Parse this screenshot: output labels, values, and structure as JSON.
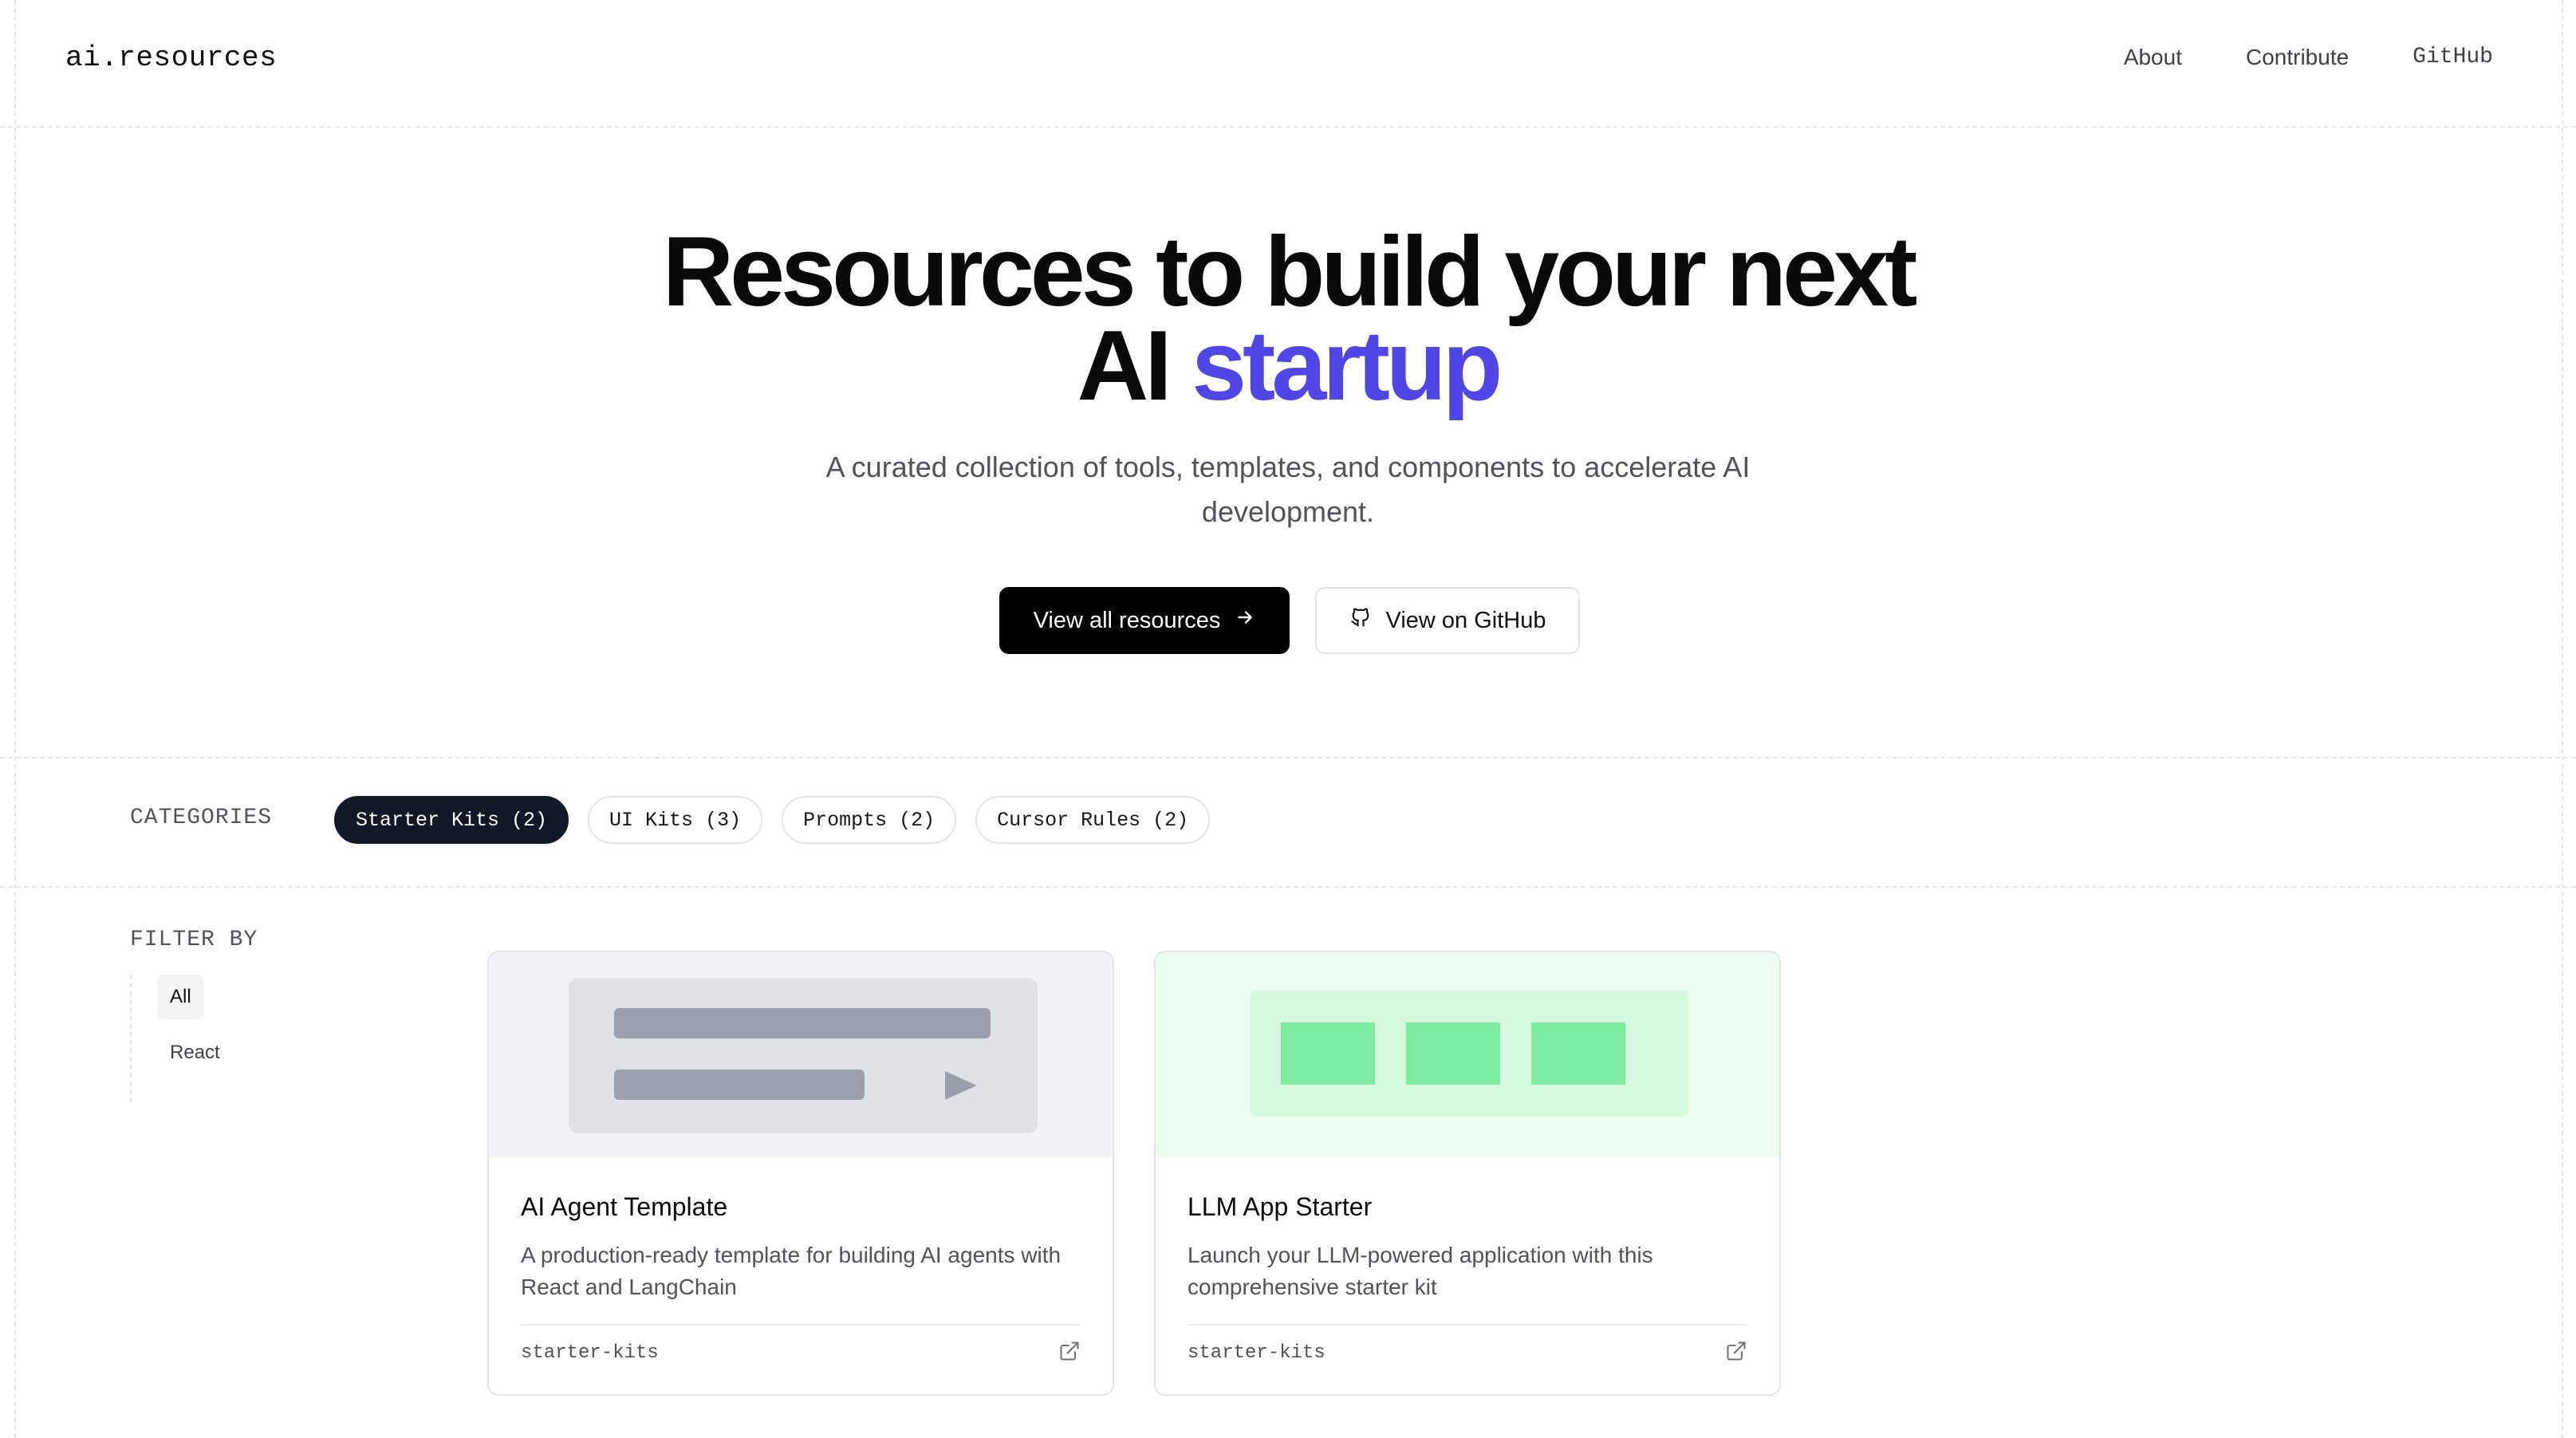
{
  "header": {
    "logo": "ai.resources",
    "nav": [
      {
        "label": "About"
      },
      {
        "label": "Contribute"
      },
      {
        "label": "GitHub"
      }
    ]
  },
  "hero": {
    "title_line1": "Resources to build your next",
    "title_line2_plain": "AI",
    "title_line2_highlight": "startup",
    "subtitle": "A curated collection of tools, templates, and components to accelerate AI development.",
    "primary_button": "View all resources",
    "secondary_button": "View on GitHub"
  },
  "categories": {
    "label": "CATEGORIES",
    "chips": [
      {
        "label": "Starter Kits (2)",
        "active": true
      },
      {
        "label": "UI Kits (3)",
        "active": false
      },
      {
        "label": "Prompts (2)",
        "active": false
      },
      {
        "label": "Cursor Rules (2)",
        "active": false
      }
    ]
  },
  "filter": {
    "label": "FILTER BY",
    "items": [
      {
        "label": "All",
        "active": true
      },
      {
        "label": "React",
        "active": false
      }
    ]
  },
  "cards": [
    {
      "title": "AI Agent Template",
      "description": "A production-ready template for building AI agents with React and LangChain",
      "tag": "starter-kits",
      "preview_color": "#f1f2f5"
    },
    {
      "title": "LLM App Starter",
      "description": "Launch your LLM-powered application with this comprehensive starter kit",
      "tag": "starter-kits",
      "preview_color": "#edfcf1"
    }
  ],
  "colors": {
    "accent": "#4f46e5",
    "accent_highlight": "#e4e6fb",
    "primary_button": "#000000",
    "active_chip": "#111827",
    "green_block": "#7deba0"
  }
}
